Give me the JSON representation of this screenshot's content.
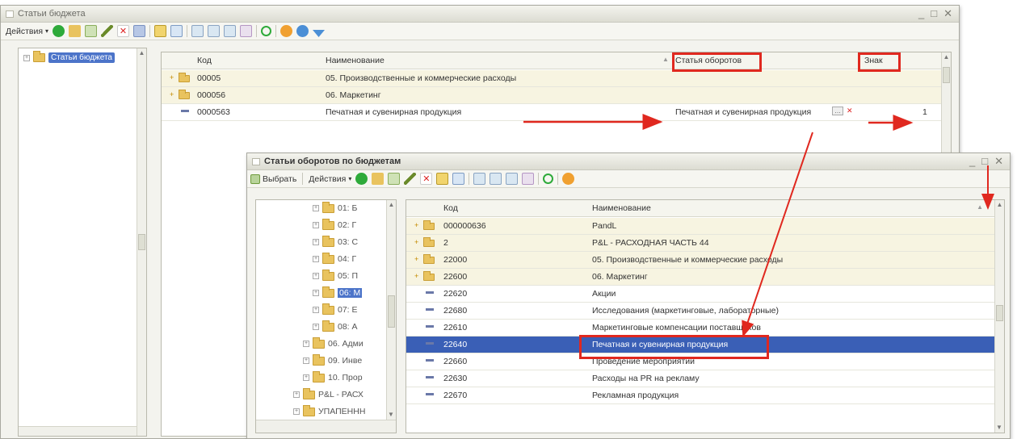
{
  "window1": {
    "title": "Статьи бюджета",
    "actions_label": "Действия",
    "tree_root": "Статьи бюджета",
    "columns": {
      "code": "Код",
      "name": "Наименование",
      "turnover": "Статья оборотов",
      "sign": "Знак"
    },
    "rows": [
      {
        "code": "00005",
        "name": "05. Производственные и коммерческие расходы",
        "turnover": "",
        "sign": "",
        "type": "group"
      },
      {
        "code": "000056",
        "name": "06. Маркетинг",
        "turnover": "",
        "sign": "",
        "type": "group"
      },
      {
        "code": "0000563",
        "name": "Печатная и сувенирная продукция",
        "turnover": "Печатная и сувенирная продукция",
        "sign": "1",
        "type": "item"
      }
    ]
  },
  "window2": {
    "title": "Статьи оборотов по бюджетам",
    "select_label": "Выбрать",
    "actions_label": "Действия",
    "columns": {
      "code": "Код",
      "name": "Наименование"
    },
    "tree": [
      {
        "label": "01: Б"
      },
      {
        "label": "02: Г"
      },
      {
        "label": "03: С"
      },
      {
        "label": "04: Г"
      },
      {
        "label": "05: П"
      },
      {
        "label": "06: М"
      },
      {
        "label": "07: Е"
      },
      {
        "label": "08: А"
      },
      {
        "label": "06. Адми"
      },
      {
        "label": "09. Инве"
      },
      {
        "label": "10. Прор"
      },
      {
        "label": "P&L - РАСХ"
      },
      {
        "label": "УПАПЕННН"
      }
    ],
    "rows": [
      {
        "code": "000000636",
        "name": "PandL",
        "type": "group"
      },
      {
        "code": "2",
        "name": "P&L - РАСХОДНАЯ ЧАСТЬ 44",
        "type": "group"
      },
      {
        "code": "22000",
        "name": "05. Производственные и коммерческие расходы",
        "type": "group"
      },
      {
        "code": "22600",
        "name": "06. Маркетинг",
        "type": "group"
      },
      {
        "code": "22620",
        "name": "Акции",
        "type": "item"
      },
      {
        "code": "22680",
        "name": "Исследования (маркетинговые, лабораторные)",
        "type": "item"
      },
      {
        "code": "22610",
        "name": "Маркетинговые компенсации поставщиков",
        "type": "item"
      },
      {
        "code": "22640",
        "name": "Печатная и сувенирная продукция",
        "type": "selected"
      },
      {
        "code": "22660",
        "name": "Проведение мероприятий",
        "type": "item"
      },
      {
        "code": "22630",
        "name": "Расходы на PR на рекламу",
        "type": "item"
      },
      {
        "code": "22670",
        "name": "Рекламная продукция",
        "type": "item"
      }
    ]
  },
  "colors": {
    "accent_red": "#e0281f",
    "selection_blue": "#3a5fb6",
    "folder": "#e9c35e"
  }
}
